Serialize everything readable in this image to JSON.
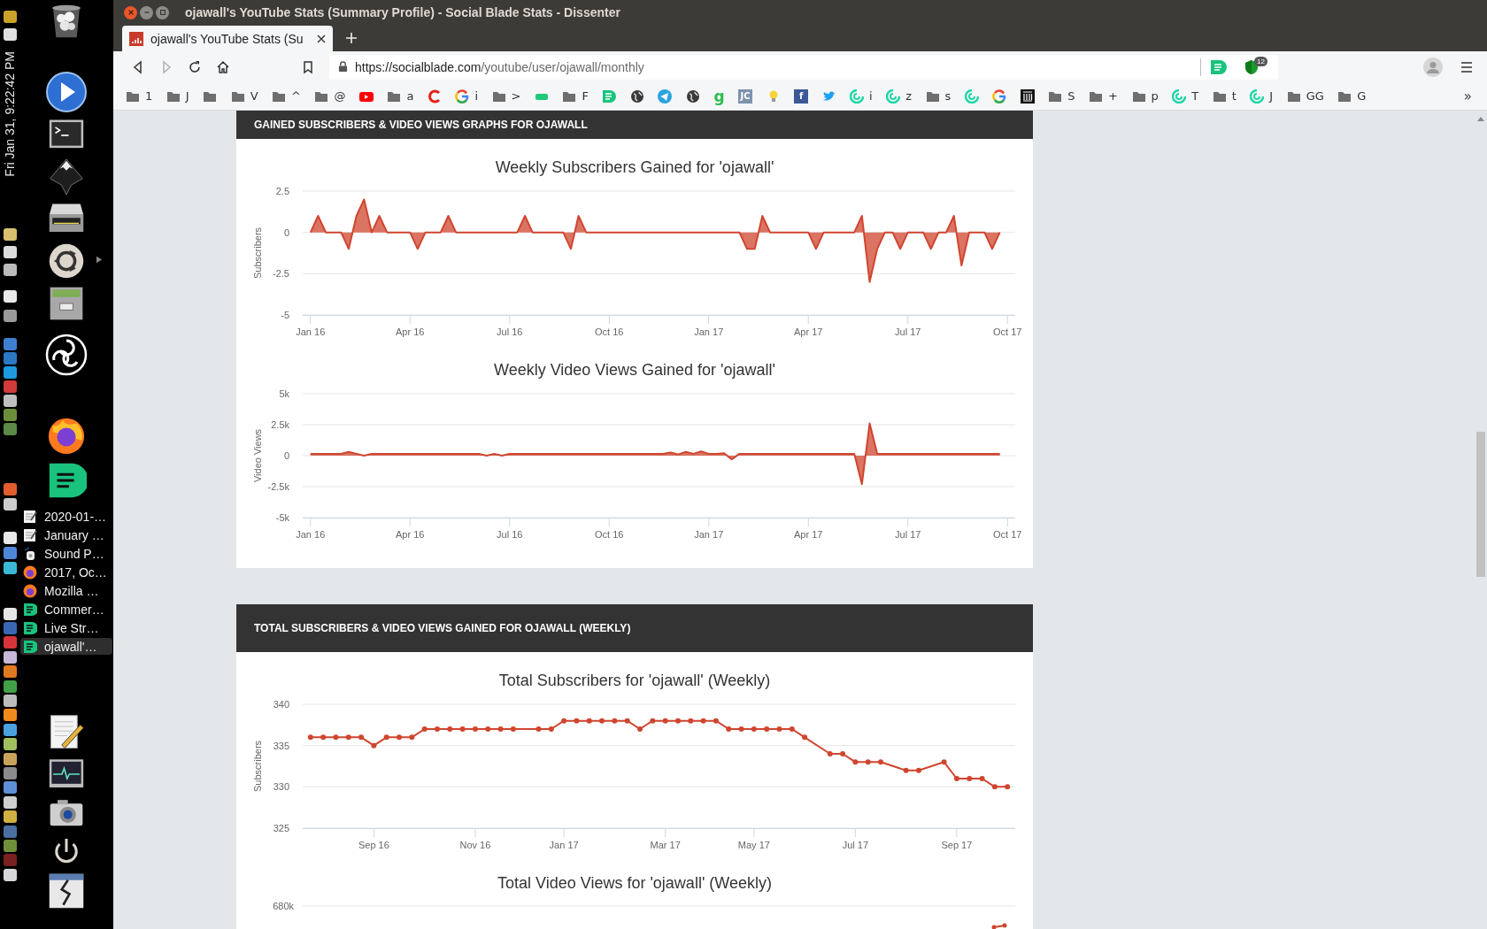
{
  "dock": {
    "clock": "Fri Jan 31, 9:22:42 PM",
    "windows": [
      {
        "kind": "note",
        "label": "2020-01-…",
        "selected": false
      },
      {
        "kind": "note",
        "label": "January …",
        "selected": false
      },
      {
        "kind": "speaker",
        "label": "Sound P…",
        "selected": false
      },
      {
        "kind": "firefox",
        "label": "2017, Oc…",
        "selected": false
      },
      {
        "kind": "firefox",
        "label": "Mozilla …",
        "selected": false
      },
      {
        "kind": "bubble",
        "label": "Commer…",
        "selected": false
      },
      {
        "kind": "bubble",
        "label": "Live Str…",
        "selected": false
      },
      {
        "kind": "bubble",
        "label": "ojawall'…",
        "selected": true
      }
    ]
  },
  "window": {
    "title": "ojawall's YouTube Stats (Summary Profile) - Social Blade Stats - Dissenter"
  },
  "tabs": [
    {
      "title": "ojawall's YouTube Stats (Su",
      "selected": true
    }
  ],
  "navigation": {
    "forward_disabled": true
  },
  "address_bar": {
    "url_host": "https://socialblade.com",
    "url_path": "/youtube/user/ojawall/monthly"
  },
  "extension_badge": "12",
  "bookmarks": [
    {
      "kind": "folder",
      "label": "1"
    },
    {
      "kind": "folder",
      "label": "J"
    },
    {
      "kind": "folder"
    },
    {
      "kind": "folder",
      "label": "V"
    },
    {
      "kind": "folder",
      "label": "^"
    },
    {
      "kind": "folder",
      "label": "@"
    },
    {
      "kind": "youtube"
    },
    {
      "kind": "folder",
      "label": "a"
    },
    {
      "kind": "ring"
    },
    {
      "kind": "google",
      "label": "i"
    },
    {
      "kind": "folder",
      "label": ">"
    },
    {
      "kind": "tag"
    },
    {
      "kind": "folder",
      "label": "F"
    },
    {
      "kind": "bubble"
    },
    {
      "kind": "globe"
    },
    {
      "kind": "plane"
    },
    {
      "kind": "globe"
    },
    {
      "kind": "letter",
      "glyph": "g"
    },
    {
      "kind": "letterbox",
      "glyph": "JC",
      "color": "#7d93ad"
    },
    {
      "kind": "bulb"
    },
    {
      "kind": "letterbox",
      "glyph": "f",
      "color": "#3b5998"
    },
    {
      "kind": "bird"
    },
    {
      "kind": "swirl",
      "label": "i"
    },
    {
      "kind": "swirl",
      "label": "z"
    },
    {
      "kind": "folder",
      "label": "s"
    },
    {
      "kind": "swirl"
    },
    {
      "kind": "google"
    },
    {
      "kind": "columns"
    },
    {
      "kind": "folder",
      "label": "S"
    },
    {
      "kind": "folder",
      "label": "+"
    },
    {
      "kind": "folder",
      "label": "p"
    },
    {
      "kind": "swirl",
      "label": "T"
    },
    {
      "kind": "folder",
      "label": "t"
    },
    {
      "kind": "swirl",
      "label": "J"
    },
    {
      "kind": "folder",
      "label": "GG"
    },
    {
      "kind": "folder",
      "label": "G"
    }
  ],
  "bookmarks_overflow": "»",
  "cards": [
    {
      "header": "GAINED SUBSCRIBERS & VIDEO VIEWS GRAPHS FOR OJAWALL",
      "charts": [
        {
          "chart_data": {
            "type": "area",
            "title": "Weekly Subscribers Gained for 'ojawall'",
            "ylabel": "Subscribers",
            "categories": [
              "Jan 16",
              null,
              null,
              null,
              null,
              null,
              null,
              null,
              null,
              null,
              null,
              null,
              null,
              "Apr 16",
              null,
              null,
              null,
              null,
              null,
              null,
              null,
              null,
              null,
              null,
              null,
              null,
              "Jul 16",
              null,
              null,
              null,
              null,
              null,
              null,
              null,
              null,
              null,
              null,
              null,
              null,
              "Oct 16",
              null,
              null,
              null,
              null,
              null,
              null,
              null,
              null,
              null,
              null,
              null,
              null,
              "Jan 17",
              null,
              null,
              null,
              null,
              null,
              null,
              null,
              null,
              null,
              null,
              null,
              null,
              "Apr 17",
              null,
              null,
              null,
              null,
              null,
              null,
              null,
              null,
              null,
              null,
              null,
              null,
              "Jul 17",
              null,
              null,
              null,
              null,
              null,
              null,
              null,
              null,
              null,
              null,
              null,
              null,
              "Oct 17"
            ],
            "series": [
              {
                "color": "#d0452f",
                "values": [
                  0,
                  1,
                  0,
                  0,
                  0,
                  -1,
                  1,
                  2,
                  0,
                  1,
                  0,
                  0,
                  0,
                  0,
                  -1,
                  0,
                  0,
                  0,
                  1,
                  0,
                  0,
                  0,
                  0,
                  0,
                  0,
                  0,
                  0,
                  0,
                  1,
                  0,
                  0,
                  0,
                  0,
                  0,
                  -1,
                  1,
                  0,
                  0,
                  0,
                  0,
                  0,
                  0,
                  0,
                  0,
                  0,
                  0,
                  0,
                  0,
                  0,
                  0,
                  0,
                  0,
                  0,
                  0,
                  0,
                  0,
                  0,
                  -1,
                  -1,
                  1,
                  0,
                  0,
                  0,
                  0,
                  0,
                  0,
                  -1,
                  0,
                  0,
                  0,
                  0,
                  0,
                  1,
                  -3,
                  -1,
                  0,
                  0,
                  -1,
                  0,
                  0,
                  0,
                  -1,
                  0,
                  0,
                  1,
                  -2,
                  0,
                  0,
                  0,
                  -1,
                  0,
                  null
                ]
              }
            ],
            "grid": true,
            "ylim": [
              -5,
              2.5
            ],
            "yticks": [
              {
                "value": 2.5,
                "label": "2.5"
              },
              {
                "value": 0,
                "label": "0"
              },
              {
                "value": -2.5,
                "label": "-2.5"
              },
              {
                "value": -5,
                "label": "-5"
              }
            ]
          }
        },
        {
          "chart_data": {
            "type": "area",
            "title": "Weekly Video Views Gained for 'ojawall'",
            "ylabel": "Video Views",
            "categories": [
              "Jan 16",
              null,
              null,
              null,
              null,
              null,
              null,
              null,
              null,
              null,
              null,
              null,
              null,
              "Apr 16",
              null,
              null,
              null,
              null,
              null,
              null,
              null,
              null,
              null,
              null,
              null,
              null,
              "Jul 16",
              null,
              null,
              null,
              null,
              null,
              null,
              null,
              null,
              null,
              null,
              null,
              null,
              "Oct 16",
              null,
              null,
              null,
              null,
              null,
              null,
              null,
              null,
              null,
              null,
              null,
              null,
              "Jan 17",
              null,
              null,
              null,
              null,
              null,
              null,
              null,
              null,
              null,
              null,
              null,
              null,
              "Apr 17",
              null,
              null,
              null,
              null,
              null,
              null,
              null,
              null,
              null,
              null,
              null,
              null,
              "Jul 17",
              null,
              null,
              null,
              null,
              null,
              null,
              null,
              null,
              null,
              null,
              null,
              null,
              "Oct 17"
            ],
            "series": [
              {
                "color": "#d0452f",
                "values": [
                  150,
                  150,
                  150,
                  150,
                  150,
                  300,
                  150,
                  0,
                  150,
                  150,
                  150,
                  150,
                  150,
                  150,
                  150,
                  150,
                  150,
                  150,
                  150,
                  150,
                  150,
                  150,
                  150,
                  0,
                  150,
                  0,
                  150,
                  150,
                  150,
                  150,
                  150,
                  150,
                  150,
                  150,
                  150,
                  150,
                  150,
                  150,
                  150,
                  150,
                  150,
                  150,
                  150,
                  150,
                  150,
                  150,
                  150,
                  250,
                  100,
                  300,
                  150,
                  350,
                  150,
                  150,
                  200,
                  -300,
                  150,
                  150,
                  150,
                  150,
                  150,
                  150,
                  150,
                  150,
                  150,
                  150,
                  150,
                  150,
                  150,
                  150,
                  150,
                  150,
                  -2300,
                  2600,
                  150,
                  150,
                  150,
                  150,
                  150,
                  150,
                  150,
                  150,
                  150,
                  150,
                  150,
                  150,
                  150,
                  150,
                  150,
                  150,
                  150,
                  null
                ]
              }
            ],
            "grid": true,
            "ylim": [
              -5000,
              5000
            ],
            "yticks": [
              {
                "value": 5000,
                "label": "5k"
              },
              {
                "value": 2500,
                "label": "2.5k"
              },
              {
                "value": 0,
                "label": "0"
              },
              {
                "value": -2500,
                "label": "-2.5k"
              },
              {
                "value": -5000,
                "label": "-5k"
              }
            ]
          }
        }
      ]
    },
    {
      "header": "TOTAL SUBSCRIBERS & VIDEO VIEWS GAINED FOR OJAWALL (WEEKLY)",
      "charts": [
        {
          "chart_data": {
            "type": "line",
            "title": "Total Subscribers for 'ojawall' (Weekly)",
            "ylabel": "Subscribers",
            "categories": [
              null,
              null,
              null,
              null,
              null,
              "Sep 16",
              null,
              null,
              null,
              null,
              null,
              null,
              null,
              "Nov 16",
              null,
              null,
              null,
              null,
              null,
              null,
              "Jan 17",
              null,
              null,
              null,
              null,
              null,
              null,
              null,
              "Mar 17",
              null,
              null,
              null,
              null,
              null,
              null,
              "May 17",
              null,
              null,
              null,
              null,
              null,
              null,
              null,
              "Jul 17",
              null,
              null,
              null,
              null,
              null,
              null,
              null,
              "Sep 17",
              null,
              null,
              null,
              null
            ],
            "series": [
              {
                "color": "#d0452f",
                "marker": "circle",
                "values": [
                  336,
                  336,
                  336,
                  336,
                  336,
                  335,
                  336,
                  336,
                  336,
                  337,
                  337,
                  337,
                  337,
                  337,
                  337,
                  337,
                  337,
                  null,
                  337,
                  337,
                  338,
                  338,
                  338,
                  338,
                  338,
                  338,
                  337,
                  338,
                  338,
                  338,
                  338,
                  338,
                  338,
                  337,
                  337,
                  337,
                  337,
                  337,
                  337,
                  336,
                  null,
                  334,
                  334,
                  333,
                  333,
                  333,
                  null,
                  332,
                  332,
                  null,
                  333,
                  331,
                  331,
                  331,
                  330,
                  330
                ]
              }
            ],
            "grid": true,
            "ylim": [
              325,
              340
            ],
            "yticks": [
              325,
              330,
              335,
              340
            ]
          }
        }
      ],
      "partial_chart": {
        "title": "Total Video Views for 'ojawall' (Weekly)",
        "ytick": "680k"
      }
    }
  ]
}
